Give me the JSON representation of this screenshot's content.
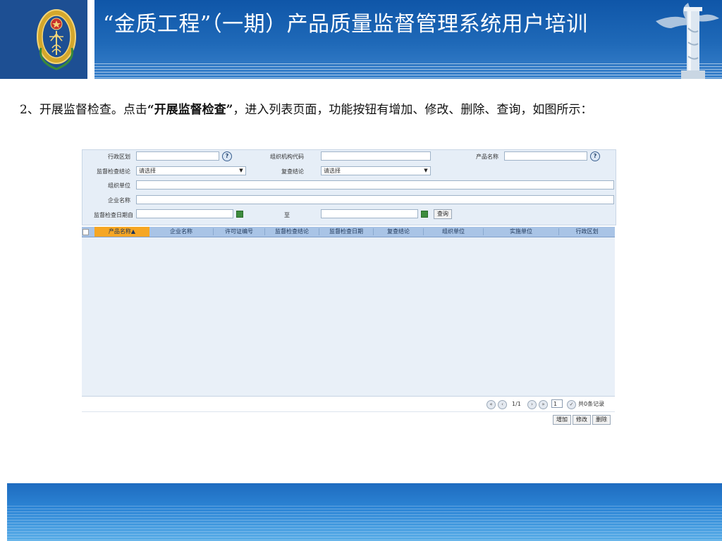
{
  "header": {
    "title": "“金质工程”（一期）产品质量监督管理系统用户培训"
  },
  "paragraph": {
    "prefix": "2、开展监督检查。点击",
    "bold": "“开展监督检查”",
    "suffix": "，进入列表页面，功能按钮有增加、修改、删除、查询，如图所示："
  },
  "form": {
    "region_label": "行政区划",
    "org_code_label": "组织机构代码",
    "product_name_label": "产品名称",
    "conclusion_label": "监督检查结论",
    "conclusion_value": "请选择",
    "recheck_label": "复查结论",
    "recheck_value": "请选择",
    "org_unit_label": "组织单位",
    "company_label": "企业名称",
    "date_from_label": "监督检查日期自",
    "date_to_label": "至",
    "query_button": "查询",
    "help_icon_text": "?"
  },
  "grid": {
    "columns": [
      "产品名称▲",
      "企业名称",
      "许可证编号",
      "监督检查结论",
      "监督检查日期",
      "复查结论",
      "组织单位",
      "实施单位",
      "行政区划"
    ]
  },
  "pager": {
    "page_info": "1/1",
    "page_input": "1",
    "total": "共0条记录"
  },
  "actions": {
    "add": "增加",
    "edit": "修改",
    "delete": "删除"
  },
  "colors": {
    "banner_blue": "#1d4f93",
    "grid_header": "#a9c4e6",
    "sort_highlight": "#f6a623"
  }
}
